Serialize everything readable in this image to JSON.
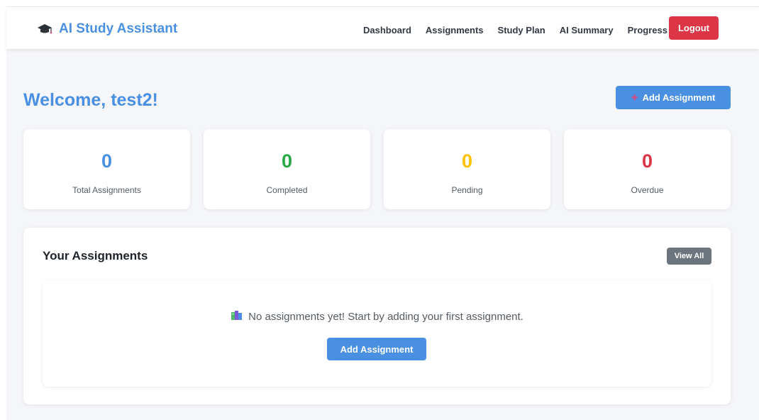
{
  "brand": {
    "title": "AI Study Assistant",
    "icon": "graduation-cap-icon"
  },
  "nav": {
    "items": [
      "Dashboard",
      "Assignments",
      "Study Plan",
      "AI Summary",
      "Progress"
    ],
    "logout_label": "Logout"
  },
  "header": {
    "welcome": "Welcome, test2!",
    "add_button_label": "Add Assignment",
    "add_button_icon": "plus-icon"
  },
  "stats": [
    {
      "value": "0",
      "label": "Total Assignments",
      "color": "#4a90e2"
    },
    {
      "value": "0",
      "label": "Completed",
      "color": "#28a745"
    },
    {
      "value": "0",
      "label": "Pending",
      "color": "#ffc107"
    },
    {
      "value": "0",
      "label": "Overdue",
      "color": "#dc3545"
    }
  ],
  "assignments": {
    "title": "Your Assignments",
    "view_all_label": "View All",
    "empty_message": "No assignments yet! Start by adding your first assignment.",
    "empty_icon": "books-icon",
    "empty_button_label": "Add Assignment"
  },
  "colors": {
    "primary": "#4a90e2",
    "danger": "#dc3545",
    "secondary": "#6c757d",
    "background": "#f5f6f9"
  }
}
